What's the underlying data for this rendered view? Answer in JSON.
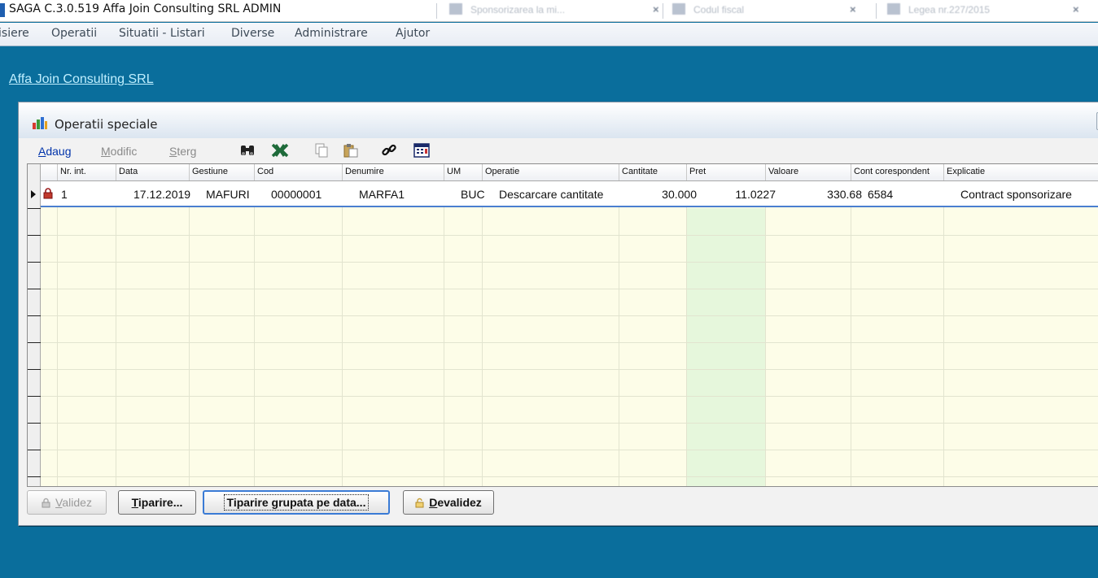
{
  "app": {
    "title": "SAGA C.3.0.519  Affa Join Consulting SRL  ADMIN",
    "company_link": "Affa Join Consulting SRL"
  },
  "browser_tabs": [
    {
      "label": "Sponsorizarea la mi..."
    },
    {
      "label": "Codul fiscal"
    },
    {
      "label": "Legea nr.227/2015"
    }
  ],
  "menu": [
    {
      "label": "Fisiere"
    },
    {
      "label": "Operatii"
    },
    {
      "label": "Situatii - Listari"
    },
    {
      "label": "Diverse"
    },
    {
      "label": "Administrare"
    },
    {
      "label": "Ajutor"
    }
  ],
  "window": {
    "title": "Operatii speciale"
  },
  "toolbar": {
    "adaug": {
      "first": "A",
      "rest": "daug"
    },
    "modific": {
      "first": "M",
      "rest": "odific"
    },
    "sterg": {
      "first": "S",
      "rest": "terg"
    },
    "icons": [
      "binoculars-icon",
      "excel-icon",
      "copy-icon",
      "paste-icon",
      "link-icon",
      "calculator-icon"
    ]
  },
  "grid": {
    "columns": [
      "Nr. int.",
      "Data",
      "Gestiune",
      "Cod",
      "Denumire",
      "UM",
      "Operatie",
      "Cantitate",
      "Pret",
      "Valoare",
      "Cont corespondent",
      "Explicatie"
    ],
    "rows": [
      {
        "nr_int": "1",
        "data": "17.12.2019",
        "gestiune": "MAFURI",
        "cod": "00000001",
        "denumire": "MARFA1",
        "um": "BUC",
        "operatie": "Descarcare cantitate",
        "cantitate": "30.000",
        "pret": "11.0227",
        "valoare": "330.68",
        "cont": "6584",
        "explicatie": "Contract sponsorizare"
      }
    ]
  },
  "buttons": {
    "validez": {
      "first": "V",
      "rest": "alidez"
    },
    "tiparire": {
      "first": "T",
      "rest": "iparire..."
    },
    "tiparire_grupata": {
      "pre": "Tiparire ",
      "first": "g",
      "rest": "rupata pe data..."
    },
    "devalidez": {
      "first": "D",
      "rest": "evalidez"
    }
  },
  "colors": {
    "desktop": "#0a6e9c",
    "grid_bg": "#fdfde8",
    "pret_col": "#e6f7dc",
    "link": "#0033aa"
  }
}
